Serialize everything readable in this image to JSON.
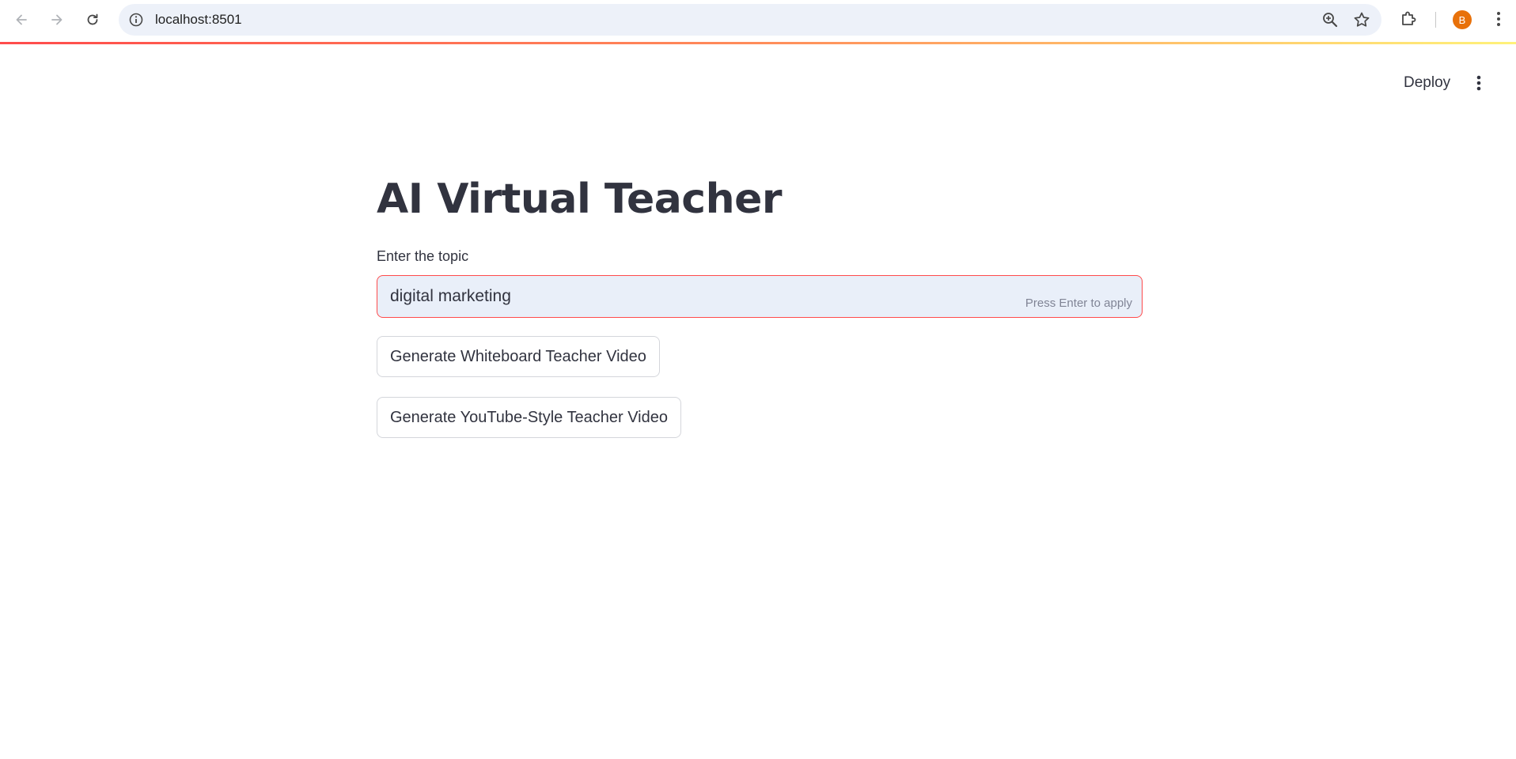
{
  "browser": {
    "url": "localhost:8501",
    "profile_initial": "B",
    "profile_color": "#e8710a",
    "icons": [
      "back-icon",
      "forward-icon",
      "reload-icon",
      "site-info-icon",
      "zoom-icon",
      "bookmark-star-icon",
      "extensions-icon",
      "chrome-menu-icon"
    ]
  },
  "header": {
    "deploy_label": "Deploy",
    "menu_icon": "kebab-menu-icon",
    "decoration_colors": [
      "#ff4b4b",
      "#ff8c5a",
      "#fff27a"
    ]
  },
  "main": {
    "title": "AI Virtual Teacher",
    "topic_field": {
      "label": "Enter the topic",
      "value": "digital marketing",
      "hint": "Press Enter to apply",
      "border_color": "#ff4b4b"
    },
    "buttons": [
      {
        "label": "Generate Whiteboard Teacher Video"
      },
      {
        "label": "Generate YouTube-Style Teacher Video"
      }
    ]
  }
}
